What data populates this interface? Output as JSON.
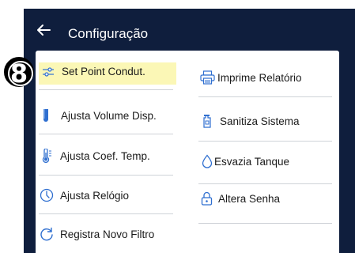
{
  "header": {
    "title": "Configuração",
    "back_icon": "arrow-left-icon"
  },
  "badge": {
    "label": "8"
  },
  "menu_left": [
    {
      "label": "Set Point Condut.",
      "icon": "sliders-icon",
      "highlighted": true
    },
    {
      "label": "Ajusta Volume Disp.",
      "icon": "test-tube-icon"
    },
    {
      "label": "Ajusta Coef. Temp.",
      "icon": "thermometer-icon"
    },
    {
      "label": "Ajusta Relógio",
      "icon": "clock-icon"
    },
    {
      "label": "Registra Novo Filtro",
      "icon": "refresh-icon"
    }
  ],
  "menu_right": [
    {
      "label": "Imprime Relatório",
      "icon": "printer-icon"
    },
    {
      "label": "Sanitiza Sistema",
      "icon": "sanitizer-bottle-icon"
    },
    {
      "label": "Esvazia Tanque",
      "icon": "water-drop-icon"
    },
    {
      "label": "Altera Senha",
      "icon": "lock-icon"
    }
  ],
  "colors": {
    "background_dark": "#0f1e3d",
    "highlight": "#fbf7b6",
    "icon_blue": "#2f6fd0"
  }
}
